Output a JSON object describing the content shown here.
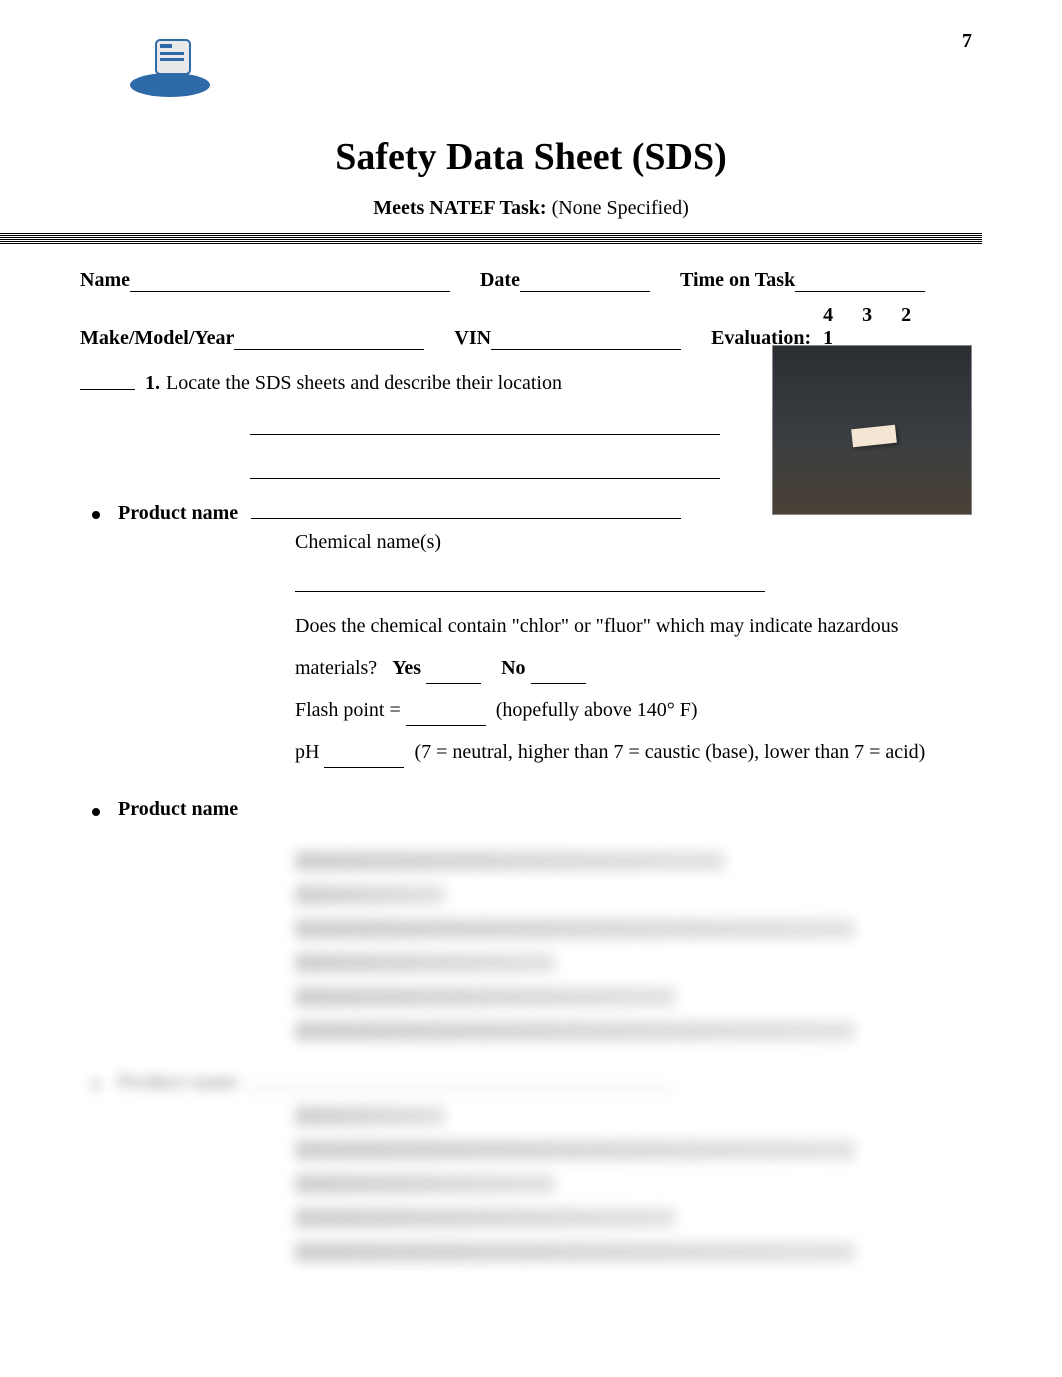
{
  "page_number": "7",
  "title": "Safety Data Sheet (SDS)",
  "subtitle_bold": "Meets NATEF Task:",
  "subtitle_rest": "  (None Specified)",
  "row1": {
    "name_label": "Name",
    "date_label": "Date",
    "time_label": "Time on Task"
  },
  "row2": {
    "mmy_label": "Make/Model/Year",
    "vin_label": "VIN",
    "eval_label": "Evaluation:",
    "eval_nums": "4  3  2  1"
  },
  "q1": {
    "num": "1.",
    "text": "Locate the SDS sheets and describe their location"
  },
  "product": {
    "label": "Product name",
    "chem_label": "Chemical name(s)",
    "hazard_q": "Does the chemical contain \"chlor\" or \"fluor\" which may indicate hazardous",
    "materials_label": "materials?",
    "yes": "Yes",
    "no": "No",
    "flash_label": "Flash point =",
    "flash_note": "(hopefully above 140° F)",
    "ph_label": "pH",
    "ph_note": "(7 = neutral, higher than 7 = caustic (base), lower than 7 = acid)"
  },
  "product2_label": "Product name",
  "product3_label": "Product name"
}
